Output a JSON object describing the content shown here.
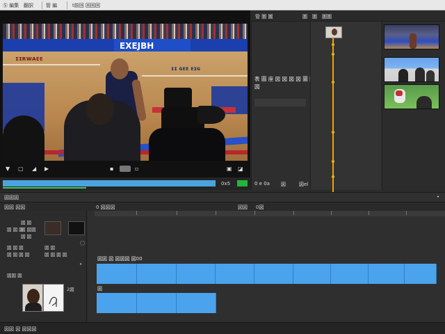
{
  "menubar": {
    "items": [
      "Ⓢ 編集",
      "翻訳",
      "管 編",
      "t前回 回回回"
    ]
  },
  "preview": {
    "court_text_left": "ɪɪʀᴡᴀᴇᴇ",
    "banner_text": "EXEJBH",
    "court_text_right": "ɪɪ ɢᴇᴇ ᴇɪɢ",
    "controls": {
      "play_icon": "play-icon",
      "loop_icon": "loop-icon",
      "back_icon": "skip-back-icon",
      "right_icons": [
        "fullscreen-icon",
        "expand-icon"
      ]
    }
  },
  "inspector": {
    "header_label": "管 圖 圖",
    "tab_labels": [
      "圖",
      "圖",
      "圖圖"
    ],
    "description": "表 圖 座 図 図 図 図 圖 圖 圖 圖 0 0 図 0.0 図"
  },
  "info_strip": {
    "timecode": "0x5",
    "status": "0 e 0a",
    "fps": "図",
    "mode": "図el"
  },
  "timeline": {
    "bar1_label": "図図図",
    "bar1_right": "•",
    "bar2_left": "図図 図図",
    "bar2_mid": "0 図図図",
    "bar2_right_a": "図図",
    "bar2_right_b": "0図",
    "left_labels": [
      "図 図",
      "図 図図",
      "図 図 図",
      "図 図",
      "図 図 図",
      "図 図 図 図",
      "図 図",
      "図 図 図 図"
    ],
    "portrait_label": "図図 図",
    "portrait_side": "2図",
    "track1_label": "図図 図 図図図 図00",
    "track2_label": "図"
  },
  "statusbar": {
    "text": "図図 図 図図図"
  }
}
